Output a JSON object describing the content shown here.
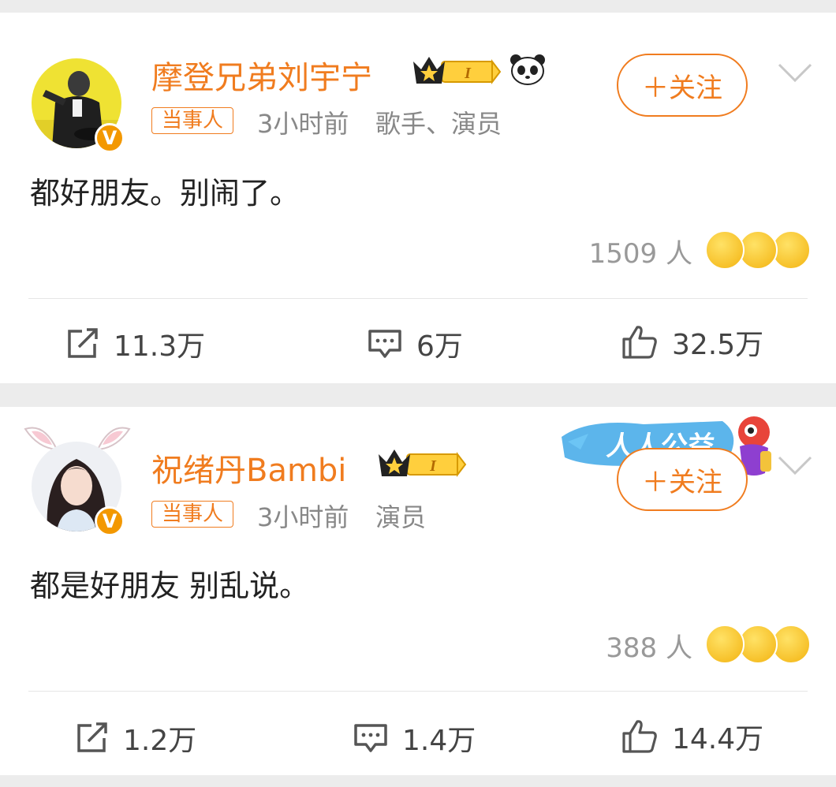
{
  "posts": [
    {
      "name": "摩登兄弟刘宇宁",
      "level": "I",
      "tag": "当事人",
      "time": "3小时前",
      "role": "歌手、演员",
      "follow": "＋关注",
      "content": "都好朋友。别闹了。",
      "reaction_count": "1509 人",
      "repost": "11.3万",
      "comment": "6万",
      "like": "32.5万",
      "verified": "V"
    },
    {
      "name": "祝绪丹Bambi",
      "level": "I",
      "tag": "当事人",
      "time": "3小时前",
      "role": "演员",
      "follow": "＋关注",
      "content": "都是好朋友 别乱说。",
      "reaction_count": "388 人",
      "repost": "1.2万",
      "comment": "1.4万",
      "like": "14.4万",
      "verified": "V",
      "sticker_text": "人人公益"
    }
  ],
  "colors": {
    "accent": "#f07c1f",
    "badge": "#f39800",
    "text": "#222222",
    "muted": "#888888"
  },
  "icons": [
    "crown-icon",
    "panda-icon",
    "chevron-down-icon",
    "repost-icon",
    "comment-icon",
    "like-icon",
    "verified-icon",
    "reaction-emoji-icon"
  ]
}
